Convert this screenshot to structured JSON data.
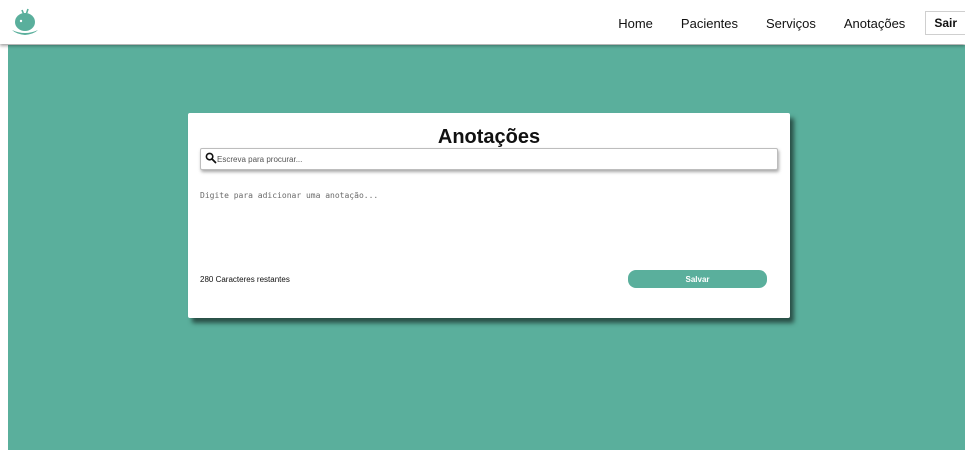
{
  "navbar": {
    "logo_icon": "whale-apple-logo-icon",
    "links": [
      {
        "label": "Home"
      },
      {
        "label": "Pacientes"
      },
      {
        "label": "Serviços"
      },
      {
        "label": "Anotações"
      }
    ],
    "logout_label": "Sair"
  },
  "card": {
    "title": "Anotações",
    "search": {
      "placeholder": "Escreva para procurar...",
      "value": "",
      "icon": "search-icon"
    },
    "note": {
      "placeholder": "Digite para adicionar uma anotação...",
      "value": ""
    },
    "chars_left": "280 Caracteres restantes",
    "save_label": "Salvar"
  },
  "colors": {
    "accent": "#5aaf9c",
    "card_bg": "#ffffff",
    "text": "#111111"
  }
}
